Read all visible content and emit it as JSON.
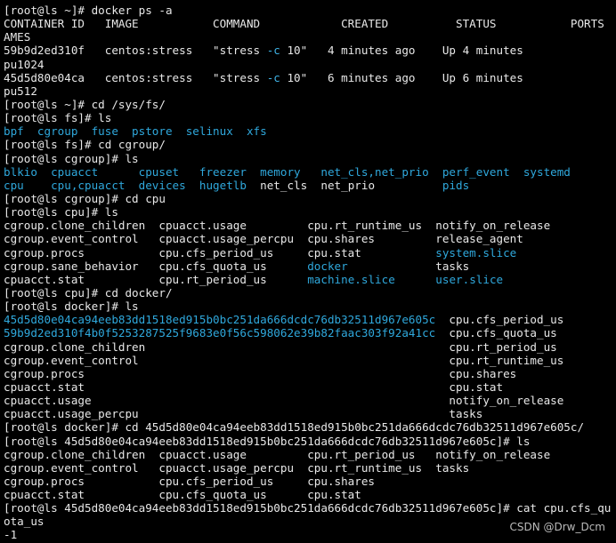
{
  "colors": {
    "background": "#000000",
    "text": "#e8e8e8",
    "directory": "#2fa8dc",
    "option_flag": "#3fb3e6"
  },
  "watermark": "CSDN @Drw_Dcm",
  "terminal_lines": [
    [
      {
        "t": "[root@ls ~]# docker ps -a",
        "c": "white"
      }
    ],
    [
      {
        "t": "CONTAINER ID   IMAGE           COMMAND            CREATED          STATUS           PORTS     N",
        "c": "white"
      }
    ],
    [
      {
        "t": "AMES",
        "c": "white"
      }
    ],
    [
      {
        "t": "59b9d2ed310f   centos:stress   \"stress ",
        "c": "white"
      },
      {
        "t": "-c",
        "c": "flag"
      },
      {
        "t": " 10\"   4 minutes ago    Up 4 minutes               c",
        "c": "white"
      }
    ],
    [
      {
        "t": "pu1024",
        "c": "white"
      }
    ],
    [
      {
        "t": "45d5d80e04ca   centos:stress   \"stress ",
        "c": "white"
      },
      {
        "t": "-c",
        "c": "flag"
      },
      {
        "t": " 10\"   6 minutes ago    Up 6 minutes               c",
        "c": "white"
      }
    ],
    [
      {
        "t": "pu512",
        "c": "white"
      }
    ],
    [
      {
        "t": "[root@ls ~]# cd /sys/fs/",
        "c": "white"
      }
    ],
    [
      {
        "t": "[root@ls fs]# ls",
        "c": "white"
      }
    ],
    [
      {
        "t": "bpf  cgroup  fuse  pstore  selinux  xfs",
        "c": "blue"
      }
    ],
    [
      {
        "t": "[root@ls fs]# cd cgroup/",
        "c": "white"
      }
    ],
    [
      {
        "t": "[root@ls cgroup]# ls",
        "c": "white"
      }
    ],
    [
      {
        "t": "blkio  cpuacct      cpuset   freezer  memory   net_cls,net_prio  perf_event  systemd",
        "c": "blue"
      }
    ],
    [
      {
        "t": "cpu    cpu,cpuacct  devices  hugetlb  ",
        "c": "blue"
      },
      {
        "t": "net_cls",
        "c": "white"
      },
      {
        "t": "  ",
        "c": "white"
      },
      {
        "t": "net_prio",
        "c": "white"
      },
      {
        "t": "          ",
        "c": "white"
      },
      {
        "t": "pids",
        "c": "blue"
      }
    ],
    [
      {
        "t": "[root@ls cgroup]# cd cpu",
        "c": "white"
      }
    ],
    [
      {
        "t": "[root@ls cpu]# ls",
        "c": "white"
      }
    ],
    [
      {
        "t": "cgroup.clone_children  cpuacct.usage         cpu.rt_runtime_us  notify_on_release",
        "c": "white"
      }
    ],
    [
      {
        "t": "cgroup.event_control   cpuacct.usage_percpu  cpu.shares         release_agent",
        "c": "white"
      }
    ],
    [
      {
        "t": "cgroup.procs           cpu.cfs_period_us     cpu.stat           ",
        "c": "white"
      },
      {
        "t": "system.slice",
        "c": "blue"
      }
    ],
    [
      {
        "t": "cgroup.sane_behavior   cpu.cfs_quota_us      ",
        "c": "white"
      },
      {
        "t": "docker",
        "c": "blue"
      },
      {
        "t": "             tasks",
        "c": "white"
      }
    ],
    [
      {
        "t": "cpuacct.stat           cpu.rt_period_us      ",
        "c": "white"
      },
      {
        "t": "machine.slice",
        "c": "blue"
      },
      {
        "t": "      ",
        "c": "white"
      },
      {
        "t": "user.slice",
        "c": "blue"
      }
    ],
    [
      {
        "t": "[root@ls cpu]# cd docker/",
        "c": "white"
      }
    ],
    [
      {
        "t": "[root@ls docker]# ls",
        "c": "white"
      }
    ],
    [
      {
        "t": "45d5d80e04ca94eeb83dd1518ed915b0bc251da666dcdc76db32511d967e605c",
        "c": "blue"
      },
      {
        "t": "  cpu.cfs_period_us",
        "c": "white"
      }
    ],
    [
      {
        "t": "59b9d2ed310f4b0f5253287525f9683e0f56c598062e39b82faac303f92a41cc",
        "c": "blue"
      },
      {
        "t": "  cpu.cfs_quota_us",
        "c": "white"
      }
    ],
    [
      {
        "t": "cgroup.clone_children                                             cpu.rt_period_us",
        "c": "white"
      }
    ],
    [
      {
        "t": "cgroup.event_control                                              cpu.rt_runtime_us",
        "c": "white"
      }
    ],
    [
      {
        "t": "cgroup.procs                                                      cpu.shares",
        "c": "white"
      }
    ],
    [
      {
        "t": "cpuacct.stat                                                      cpu.stat",
        "c": "white"
      }
    ],
    [
      {
        "t": "cpuacct.usage                                                     notify_on_release",
        "c": "white"
      }
    ],
    [
      {
        "t": "cpuacct.usage_percpu                                              tasks",
        "c": "white"
      }
    ],
    [
      {
        "t": "[root@ls docker]# cd 45d5d80e04ca94eeb83dd1518ed915b0bc251da666dcdc76db32511d967e605c/",
        "c": "white"
      }
    ],
    [
      {
        "t": "[root@ls 45d5d80e04ca94eeb83dd1518ed915b0bc251da666dcdc76db32511d967e605c]# ls",
        "c": "white"
      }
    ],
    [
      {
        "t": "cgroup.clone_children  cpuacct.usage         cpu.rt_period_us   notify_on_release",
        "c": "white"
      }
    ],
    [
      {
        "t": "cgroup.event_control   cpuacct.usage_percpu  cpu.rt_runtime_us  tasks",
        "c": "white"
      }
    ],
    [
      {
        "t": "cgroup.procs           cpu.cfs_period_us     cpu.shares",
        "c": "white"
      }
    ],
    [
      {
        "t": "cpuacct.stat           cpu.cfs_quota_us      cpu.stat",
        "c": "white"
      }
    ],
    [
      {
        "t": "[root@ls 45d5d80e04ca94eeb83dd1518ed915b0bc251da666dcdc76db32511d967e605c]# cat cpu.cfs_qu",
        "c": "white"
      }
    ],
    [
      {
        "t": "ota_us",
        "c": "white"
      }
    ],
    [
      {
        "t": "-1",
        "c": "white"
      }
    ]
  ]
}
